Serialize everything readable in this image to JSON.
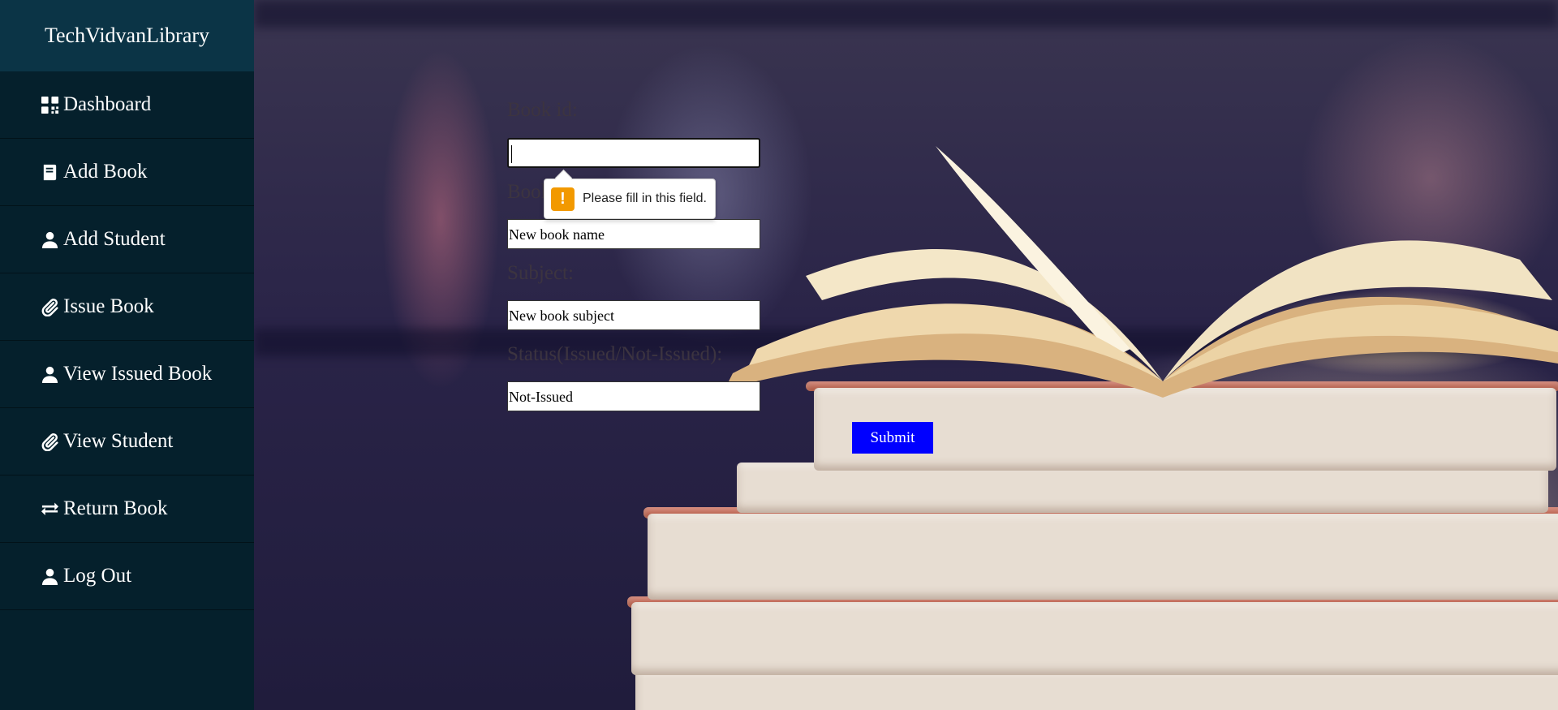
{
  "app": {
    "brand": "TechVidvanLibrary"
  },
  "sidebar": {
    "items": [
      {
        "label": "Dashboard",
        "icon": "dashboard-grid-icon"
      },
      {
        "label": "Add Book",
        "icon": "book-icon"
      },
      {
        "label": "Add Student",
        "icon": "user-icon"
      },
      {
        "label": "Issue Book",
        "icon": "paperclip-icon"
      },
      {
        "label": "View Issued Book",
        "icon": "user-icon"
      },
      {
        "label": "View Student",
        "icon": "paperclip-icon"
      },
      {
        "label": "Return Book",
        "icon": "exchange-arrows-icon"
      },
      {
        "label": "Log Out",
        "icon": "user-icon"
      }
    ]
  },
  "form": {
    "book_id": {
      "label": "Book id:",
      "value": ""
    },
    "book_name": {
      "label": "Book name:",
      "value": "New book name"
    },
    "subject": {
      "label": "Subject:",
      "value": "New book subject"
    },
    "status": {
      "label": "Status(Issued/Not-Issued):",
      "value": "Not-Issued"
    },
    "submit_label": "Submit"
  },
  "validation": {
    "message": "Please fill in this field.",
    "icon": "warning-icon"
  },
  "colors": {
    "sidebar_bg": "#05202c",
    "brand_bg": "#0b3446",
    "submit_bg": "#0000ff",
    "warning": "#f29900"
  }
}
